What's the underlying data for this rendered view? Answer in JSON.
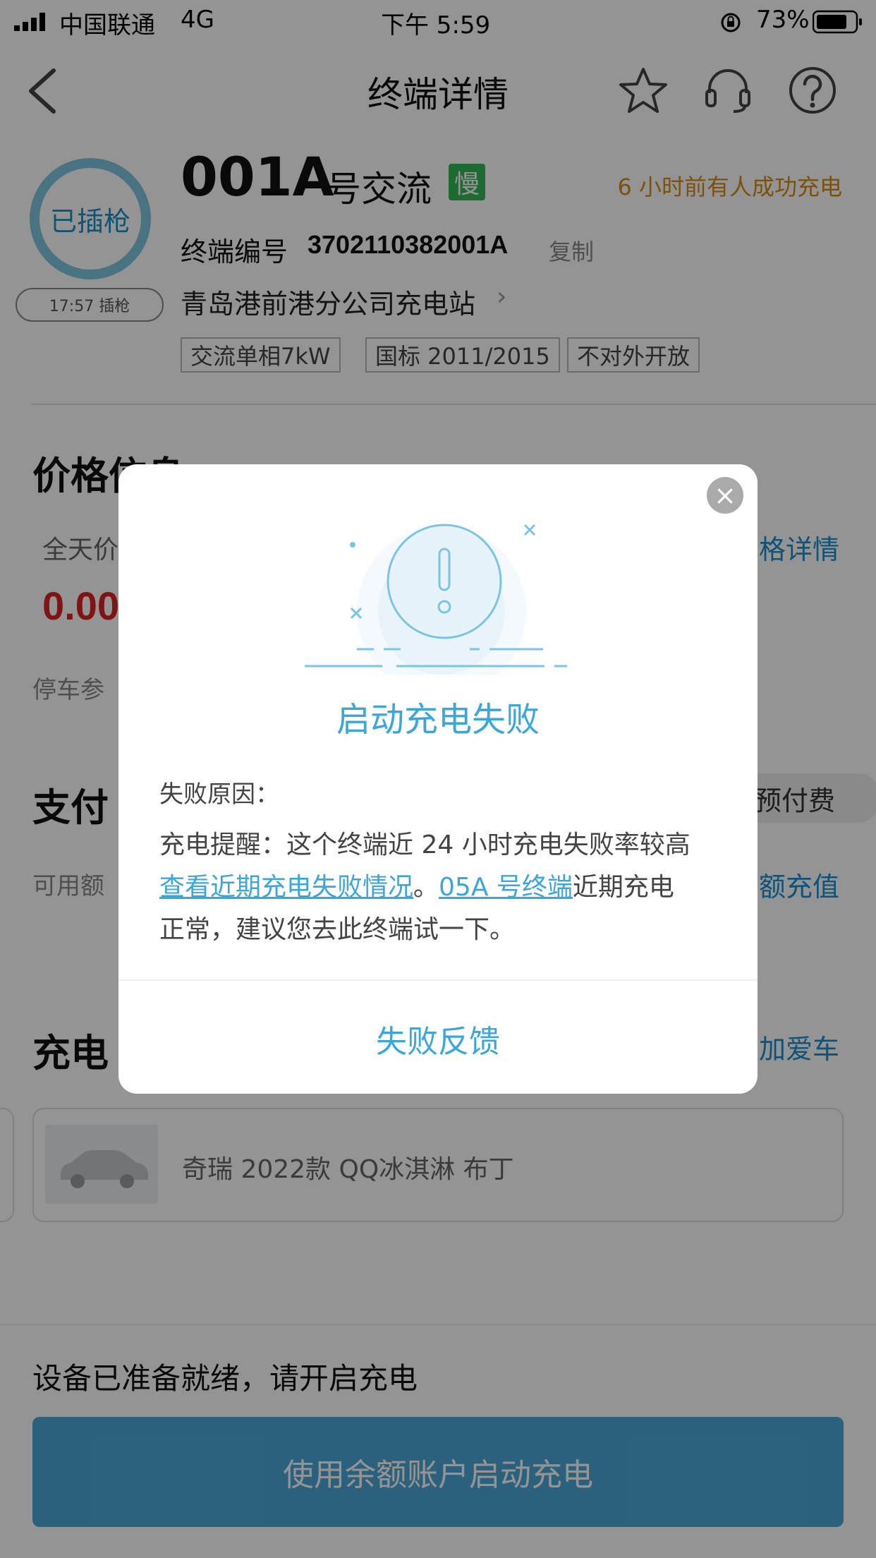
{
  "status_bar": {
    "carrier": "中国联通",
    "network": "4G",
    "time": "下午 5:59",
    "battery": "73%"
  },
  "nav": {
    "title": "终端详情",
    "icons": [
      "back-icon",
      "star-icon",
      "headset-icon",
      "help-icon"
    ]
  },
  "terminal": {
    "ring_label": "已插枪",
    "plug_time": "17:57 插枪",
    "number": "001A",
    "number_suffix": "号交流",
    "speed_tag": "慢",
    "recent_success": "6 小时前有人成功充电",
    "code_label": "终端编号",
    "code": "3702110382001A",
    "copy": "复制",
    "station": "青岛港前港分公司充电站",
    "tags": [
      "交流单相7kW",
      "国标 2011/2015",
      "不对外开放"
    ]
  },
  "price": {
    "section_title": "价格信息",
    "all_day": "全天价",
    "value": "0.00",
    "detail_link": "格详情",
    "parking": "停车参"
  },
  "payment": {
    "section_title": "支付",
    "prepaid_pill": "预付费",
    "available": "可用额",
    "recharge_link": "额充值"
  },
  "car": {
    "section_title": "充电",
    "add_link": "加爱车",
    "name": "奇瑞 2022款 QQ冰淇淋 布丁"
  },
  "bottom": {
    "ready_text": "设备已准备就绪，请开启充电",
    "start_button": "使用余额账户启动充电"
  },
  "modal": {
    "title": "启动充电失败",
    "reason_label": "失败原因：",
    "reminder": "充电提醒：这个终端近 24 小时充电失败率较高",
    "failure_link": "查看近期充电失败情况",
    "period": "。",
    "alt_terminal_link": "05A 号终端",
    "alt_text_1": "近期充电",
    "alt_text_2": "正常，建议您去此终端试一下。",
    "feedback": "失败反馈"
  },
  "colors": {
    "accent": "#3ba7d8",
    "price_red": "#d22222",
    "slow_green": "#34b857",
    "recent_orange": "#d38e16"
  }
}
